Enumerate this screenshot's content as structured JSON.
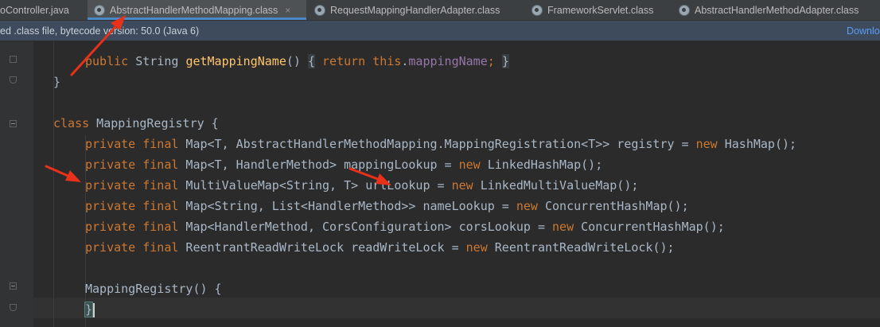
{
  "tabs": [
    {
      "label": "oController.java",
      "active": false,
      "has_icon": false
    },
    {
      "label": "AbstractHandlerMethodMapping.class",
      "active": true,
      "has_icon": true
    },
    {
      "label": "RequestMappingHandlerAdapter.class",
      "active": false,
      "has_icon": true
    },
    {
      "label": "FrameworkServlet.class",
      "active": false,
      "has_icon": true
    },
    {
      "label": "AbstractHandlerMethodAdapter.class",
      "active": false,
      "has_icon": true
    }
  ],
  "tab_close_glyph": "×",
  "infobar": {
    "message": "ed .class file, bytecode version: 50.0 (Java 6)",
    "link": "Downlo"
  },
  "code": {
    "l1": {
      "kw1": "public",
      "t1": " String ",
      "fn": "getMappingName",
      "t2": "() ",
      "b1": "{",
      "sp1": " ",
      "kw2": "return",
      "sp2": " ",
      "kw3": "this",
      "t3": ".",
      "fld": "mappingName",
      "semi": ";",
      "sp3": " ",
      "b2": "}"
    },
    "l2": "}",
    "l3": {
      "kw": "class",
      "t": " MappingRegistry {"
    },
    "l4": {
      "kw1": "private",
      "kw2": "final",
      "t1": " Map<T, AbstractHandlerMethodMapping.MappingRegistration<T>> registry = ",
      "kw3": "new",
      "t2": " HashMap();"
    },
    "l5": {
      "kw1": "private",
      "kw2": "final",
      "t1": " Map<T, HandlerMethod> mappingLookup = ",
      "kw3": "new",
      "t2": " LinkedHashMap();"
    },
    "l6": {
      "kw1": "private",
      "kw2": "final",
      "t1": " MultiValueMap<String, T> urlLookup = ",
      "kw3": "new",
      "t2": " LinkedMultiValueMap();"
    },
    "l7": {
      "kw1": "private",
      "kw2": "final",
      "t1": " Map<String, List<HandlerMethod>> nameLookup = ",
      "kw3": "new",
      "t2": " ConcurrentHashMap();"
    },
    "l8": {
      "kw1": "private",
      "kw2": "final",
      "t1": " Map<HandlerMethod, CorsConfiguration> corsLookup = ",
      "kw3": "new",
      "t2": " ConcurrentHashMap();"
    },
    "l9": {
      "kw1": "private",
      "kw2": "final",
      "t1": " ReentrantReadWriteLock readWriteLock = ",
      "kw3": "new",
      "t2": " ReentrantReadWriteLock();"
    },
    "l10": "MappingRegistry() {",
    "l11": "}"
  },
  "colors": {
    "editor_bg": "#2b2b2b",
    "keyword": "#cc7832",
    "field": "#9876aa",
    "method": "#ffc66d",
    "text": "#a9b7c6",
    "annotation_arrow": "#e8311a",
    "active_tab_underline": "#4a88c7"
  },
  "annotations": [
    {
      "name": "red-arrow",
      "points_to": "AbstractHandlerMethodMapping.class tab"
    },
    {
      "name": "red-arrow",
      "points_to": "private final MultiValueMap line"
    },
    {
      "name": "red-arrow",
      "points_to": "urlLookup"
    }
  ]
}
